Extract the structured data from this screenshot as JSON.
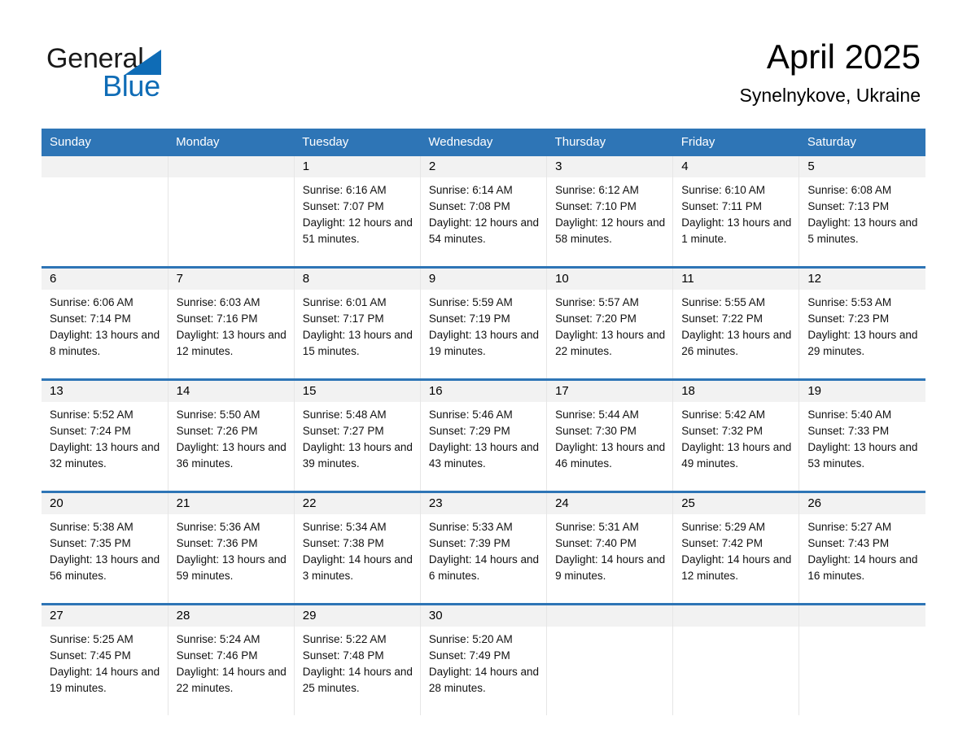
{
  "brand": {
    "name_part1": "General",
    "name_part2": "Blue",
    "triangle_color": "#0f6cb6",
    "text_color": "#1a1a1a"
  },
  "header": {
    "title": "April 2025",
    "location": "Synelnykove, Ukraine"
  },
  "theme": {
    "header_blue": "#2e75b6",
    "row_rule_blue": "#2e75b6",
    "daynum_band_gray": "#f2f2f2",
    "cell_border": "#e6e6e6"
  },
  "weekdays": [
    "Sunday",
    "Monday",
    "Tuesday",
    "Wednesday",
    "Thursday",
    "Friday",
    "Saturday"
  ],
  "weeks": [
    [
      {
        "day": "",
        "sunrise": "",
        "sunset": "",
        "daylight": ""
      },
      {
        "day": "",
        "sunrise": "",
        "sunset": "",
        "daylight": ""
      },
      {
        "day": "1",
        "sunrise": "Sunrise: 6:16 AM",
        "sunset": "Sunset: 7:07 PM",
        "daylight": "Daylight: 12 hours and 51 minutes."
      },
      {
        "day": "2",
        "sunrise": "Sunrise: 6:14 AM",
        "sunset": "Sunset: 7:08 PM",
        "daylight": "Daylight: 12 hours and 54 minutes."
      },
      {
        "day": "3",
        "sunrise": "Sunrise: 6:12 AM",
        "sunset": "Sunset: 7:10 PM",
        "daylight": "Daylight: 12 hours and 58 minutes."
      },
      {
        "day": "4",
        "sunrise": "Sunrise: 6:10 AM",
        "sunset": "Sunset: 7:11 PM",
        "daylight": "Daylight: 13 hours and 1 minute."
      },
      {
        "day": "5",
        "sunrise": "Sunrise: 6:08 AM",
        "sunset": "Sunset: 7:13 PM",
        "daylight": "Daylight: 13 hours and 5 minutes."
      }
    ],
    [
      {
        "day": "6",
        "sunrise": "Sunrise: 6:06 AM",
        "sunset": "Sunset: 7:14 PM",
        "daylight": "Daylight: 13 hours and 8 minutes."
      },
      {
        "day": "7",
        "sunrise": "Sunrise: 6:03 AM",
        "sunset": "Sunset: 7:16 PM",
        "daylight": "Daylight: 13 hours and 12 minutes."
      },
      {
        "day": "8",
        "sunrise": "Sunrise: 6:01 AM",
        "sunset": "Sunset: 7:17 PM",
        "daylight": "Daylight: 13 hours and 15 minutes."
      },
      {
        "day": "9",
        "sunrise": "Sunrise: 5:59 AM",
        "sunset": "Sunset: 7:19 PM",
        "daylight": "Daylight: 13 hours and 19 minutes."
      },
      {
        "day": "10",
        "sunrise": "Sunrise: 5:57 AM",
        "sunset": "Sunset: 7:20 PM",
        "daylight": "Daylight: 13 hours and 22 minutes."
      },
      {
        "day": "11",
        "sunrise": "Sunrise: 5:55 AM",
        "sunset": "Sunset: 7:22 PM",
        "daylight": "Daylight: 13 hours and 26 minutes."
      },
      {
        "day": "12",
        "sunrise": "Sunrise: 5:53 AM",
        "sunset": "Sunset: 7:23 PM",
        "daylight": "Daylight: 13 hours and 29 minutes."
      }
    ],
    [
      {
        "day": "13",
        "sunrise": "Sunrise: 5:52 AM",
        "sunset": "Sunset: 7:24 PM",
        "daylight": "Daylight: 13 hours and 32 minutes."
      },
      {
        "day": "14",
        "sunrise": "Sunrise: 5:50 AM",
        "sunset": "Sunset: 7:26 PM",
        "daylight": "Daylight: 13 hours and 36 minutes."
      },
      {
        "day": "15",
        "sunrise": "Sunrise: 5:48 AM",
        "sunset": "Sunset: 7:27 PM",
        "daylight": "Daylight: 13 hours and 39 minutes."
      },
      {
        "day": "16",
        "sunrise": "Sunrise: 5:46 AM",
        "sunset": "Sunset: 7:29 PM",
        "daylight": "Daylight: 13 hours and 43 minutes."
      },
      {
        "day": "17",
        "sunrise": "Sunrise: 5:44 AM",
        "sunset": "Sunset: 7:30 PM",
        "daylight": "Daylight: 13 hours and 46 minutes."
      },
      {
        "day": "18",
        "sunrise": "Sunrise: 5:42 AM",
        "sunset": "Sunset: 7:32 PM",
        "daylight": "Daylight: 13 hours and 49 minutes."
      },
      {
        "day": "19",
        "sunrise": "Sunrise: 5:40 AM",
        "sunset": "Sunset: 7:33 PM",
        "daylight": "Daylight: 13 hours and 53 minutes."
      }
    ],
    [
      {
        "day": "20",
        "sunrise": "Sunrise: 5:38 AM",
        "sunset": "Sunset: 7:35 PM",
        "daylight": "Daylight: 13 hours and 56 minutes."
      },
      {
        "day": "21",
        "sunrise": "Sunrise: 5:36 AM",
        "sunset": "Sunset: 7:36 PM",
        "daylight": "Daylight: 13 hours and 59 minutes."
      },
      {
        "day": "22",
        "sunrise": "Sunrise: 5:34 AM",
        "sunset": "Sunset: 7:38 PM",
        "daylight": "Daylight: 14 hours and 3 minutes."
      },
      {
        "day": "23",
        "sunrise": "Sunrise: 5:33 AM",
        "sunset": "Sunset: 7:39 PM",
        "daylight": "Daylight: 14 hours and 6 minutes."
      },
      {
        "day": "24",
        "sunrise": "Sunrise: 5:31 AM",
        "sunset": "Sunset: 7:40 PM",
        "daylight": "Daylight: 14 hours and 9 minutes."
      },
      {
        "day": "25",
        "sunrise": "Sunrise: 5:29 AM",
        "sunset": "Sunset: 7:42 PM",
        "daylight": "Daylight: 14 hours and 12 minutes."
      },
      {
        "day": "26",
        "sunrise": "Sunrise: 5:27 AM",
        "sunset": "Sunset: 7:43 PM",
        "daylight": "Daylight: 14 hours and 16 minutes."
      }
    ],
    [
      {
        "day": "27",
        "sunrise": "Sunrise: 5:25 AM",
        "sunset": "Sunset: 7:45 PM",
        "daylight": "Daylight: 14 hours and 19 minutes."
      },
      {
        "day": "28",
        "sunrise": "Sunrise: 5:24 AM",
        "sunset": "Sunset: 7:46 PM",
        "daylight": "Daylight: 14 hours and 22 minutes."
      },
      {
        "day": "29",
        "sunrise": "Sunrise: 5:22 AM",
        "sunset": "Sunset: 7:48 PM",
        "daylight": "Daylight: 14 hours and 25 minutes."
      },
      {
        "day": "30",
        "sunrise": "Sunrise: 5:20 AM",
        "sunset": "Sunset: 7:49 PM",
        "daylight": "Daylight: 14 hours and 28 minutes."
      },
      {
        "day": "",
        "sunrise": "",
        "sunset": "",
        "daylight": ""
      },
      {
        "day": "",
        "sunrise": "",
        "sunset": "",
        "daylight": ""
      },
      {
        "day": "",
        "sunrise": "",
        "sunset": "",
        "daylight": ""
      }
    ]
  ]
}
